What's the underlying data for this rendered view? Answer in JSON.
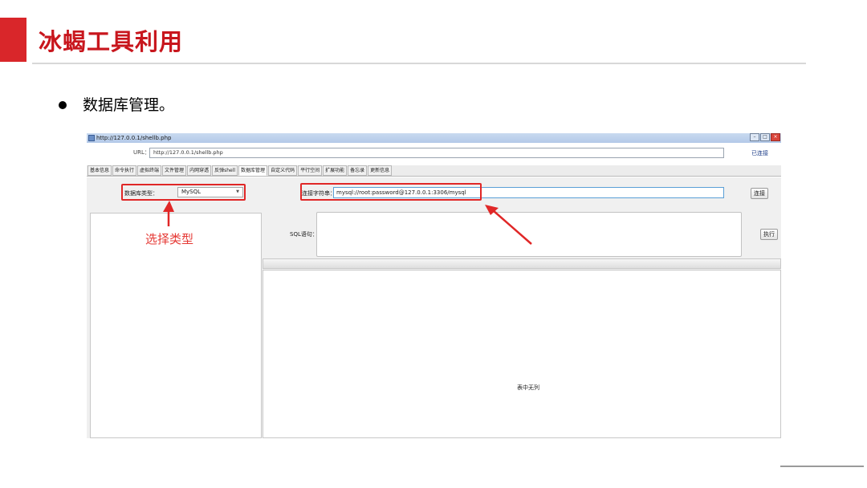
{
  "slide": {
    "title": "冰蝎工具利用",
    "bullet": "数据库管理。"
  },
  "window": {
    "title": "http://127.0.0.1/shellb.php",
    "url_label": "URL：",
    "url_value": "http://127.0.0.1/shellb.php",
    "status": "已连接"
  },
  "tabs": [
    {
      "label": "基本信息"
    },
    {
      "label": "命令执行"
    },
    {
      "label": "虚拟终端"
    },
    {
      "label": "文件管理"
    },
    {
      "label": "内网穿透"
    },
    {
      "label": "反弹shell"
    },
    {
      "label": "数据库管理",
      "active": true
    },
    {
      "label": "自定义代码"
    },
    {
      "label": "平行空间"
    },
    {
      "label": "扩展功能"
    },
    {
      "label": "备忘录"
    },
    {
      "label": "更新信息"
    }
  ],
  "db": {
    "type_label": "数据库类型：",
    "type_value": "MySQL",
    "connstr_label": "连接字符串：",
    "connstr_value": "mysql://root:password@127.0.0.1:3306/mysql",
    "connect_button": "连接",
    "sql_label": "SQL语句：",
    "exec_button": "执行",
    "empty_result": "表中无列"
  },
  "annotations": {
    "select_type_label": "选择类型",
    "color": "#e02727"
  }
}
